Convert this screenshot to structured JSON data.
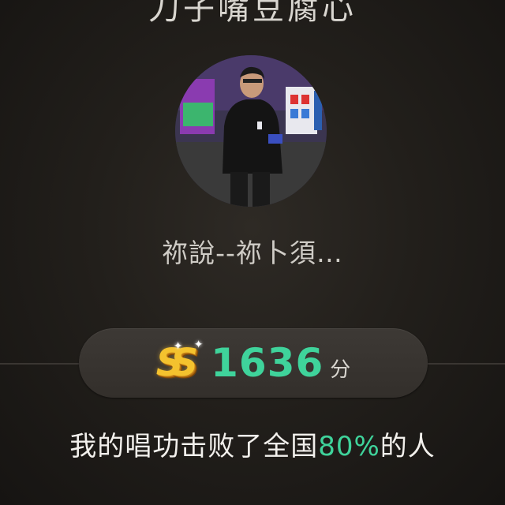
{
  "song": {
    "title": "刀子嘴豆腐心"
  },
  "user": {
    "name": "祢說--祢卜須…"
  },
  "score": {
    "grade": "SS",
    "value": "1636",
    "unit": "分"
  },
  "result": {
    "prefix": "我的唱功击败了全国",
    "percent": "80%",
    "suffix": "的人"
  },
  "colors": {
    "accent_green": "#3fd39b",
    "grade_gold": "#f4c22e",
    "background": "#1c1a17"
  }
}
